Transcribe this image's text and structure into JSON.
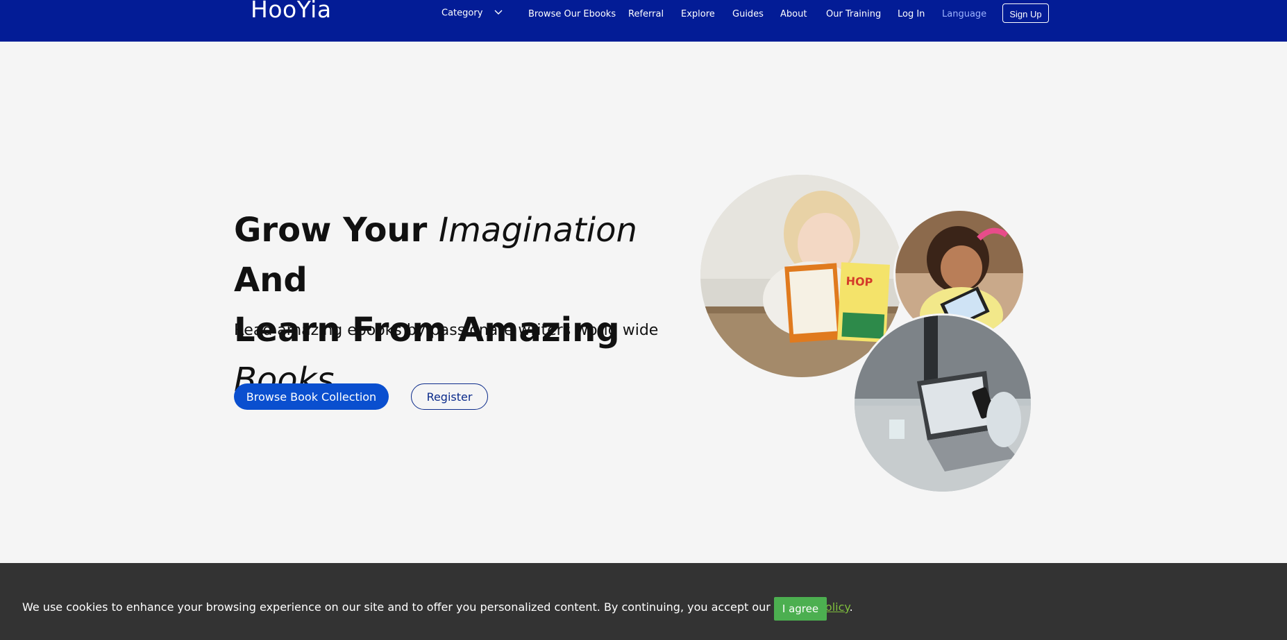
{
  "header": {
    "logo": "HooYia",
    "category_label": "Category",
    "nav": [
      {
        "label": "Browse Our Ebooks"
      },
      {
        "label": "Referral"
      },
      {
        "label": "Explore"
      },
      {
        "label": "Guides"
      },
      {
        "label": "About"
      },
      {
        "label": "Our Training"
      },
      {
        "label": "Log In"
      },
      {
        "label": "Language"
      }
    ],
    "signup_label": "Sign Up"
  },
  "hero": {
    "title_part1": "Grow Your ",
    "title_em1": "Imagination",
    "title_part2": " And",
    "title_part3": "Learn From Amazing ",
    "title_em2": "Books",
    "subtitle": "Read amazing ebooks by passionate writers world wide",
    "primary_button": "Browse Book Collection",
    "secondary_button": "Register"
  },
  "cookie": {
    "text": "We use cookies to enhance your browsing experience on our site and to offer you personalized content. By continuing, you accept our ",
    "link": "privacy policy",
    "period": ".",
    "button": "I agree"
  },
  "colors": {
    "navbar": "#031c96",
    "primary": "#0a4fcf",
    "cookie_bg": "#333333",
    "agree": "#4caf50",
    "link": "#7fbf3d"
  }
}
